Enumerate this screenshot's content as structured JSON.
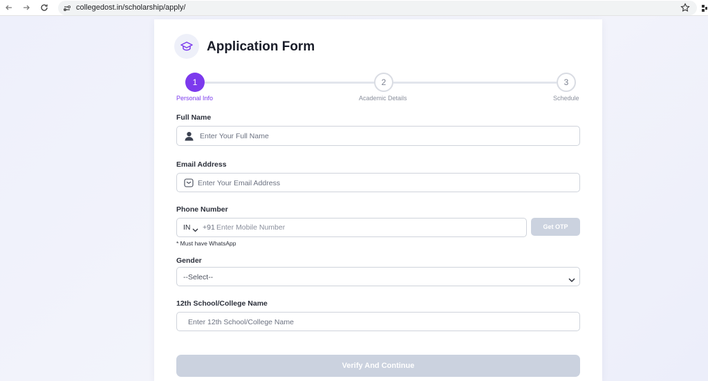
{
  "browser": {
    "url": "collegedost.in/scholarship/apply/"
  },
  "form": {
    "title": "Application Form",
    "steps": [
      {
        "number": "1",
        "label": "Personal Info"
      },
      {
        "number": "2",
        "label": "Academic Details"
      },
      {
        "number": "3",
        "label": "Schedule"
      }
    ],
    "full_name": {
      "label": "Full Name",
      "placeholder": "Enter Your Full Name"
    },
    "email": {
      "label": "Email Address",
      "placeholder": "Enter Your Email Address"
    },
    "phone": {
      "label": "Phone Number",
      "country": "IN",
      "code": "+91",
      "placeholder": "Enter Mobile Number",
      "otp_label": "Get OTP",
      "hint": "* Must have WhatsApp"
    },
    "gender": {
      "label": "Gender",
      "selected": "--Select--"
    },
    "school": {
      "label": "12th School/College Name",
      "placeholder": "Enter 12th School/College Name"
    },
    "submit_label": "Verify And Continue"
  },
  "colors": {
    "accent": "#7c3aed",
    "disabled_button": "#cbd2df"
  }
}
